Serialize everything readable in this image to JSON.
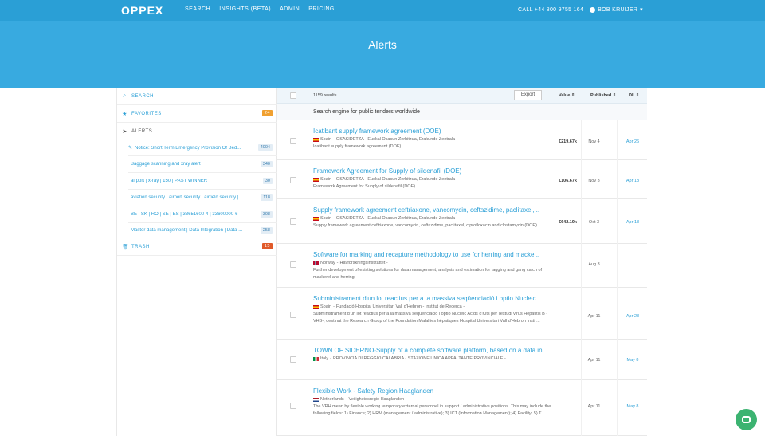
{
  "nav": {
    "logo": "OPPEX",
    "links": [
      "SEARCH",
      "INSIGHTS (BETA)",
      "ADMIN",
      "PRICING"
    ],
    "phone": "CALL +44 800 9755 164",
    "user": "BOB KRUIJER"
  },
  "page": {
    "title": "Alerts"
  },
  "sidebar": {
    "search": "SEARCH",
    "favorites": {
      "label": "FAVORITES",
      "count": "24"
    },
    "alerts": "ALERTS",
    "alert_items": [
      {
        "label": "Notice: Short Term Emergency Provision Of Bed...",
        "count": "4004"
      },
      {
        "label": "Baggage scanning and xray alert",
        "count": "340"
      },
      {
        "label": "airport | x-ray | 150 | PAST WINNER",
        "count": "30"
      },
      {
        "label": "aviation security | airport security | airfield security |...",
        "count": "118"
      },
      {
        "label": "BE | SK | RO | SE | ES | 33651600-4 | 33600000-6",
        "count": "308"
      },
      {
        "label": "Master data management | Data Integration | Data ...",
        "count": "258"
      }
    ],
    "trash": {
      "label": "TRASH",
      "count": "15"
    }
  },
  "table": {
    "results": "1159 results",
    "export": "Export",
    "col_value": "Value ⇕",
    "col_published": "Published ⇕",
    "col_dl": "DL ⇕",
    "subheading": "Search engine for public tenders worldwide"
  },
  "rows": [
    {
      "title": "Icatibant supply framework agreement (DOE)",
      "country": "Spain",
      "meta": "OSAKIDETZA - Euskal Osasun Zerbitzua, Erakunde Zentrala -",
      "desc": "Icatibant supply framework agreement (DOE)",
      "value": "€219.67k",
      "published": "Nov 4",
      "dl": "Apr 26",
      "flag": "es"
    },
    {
      "title": "Framework Agreement for Supply of sildenafil (DOE)",
      "country": "Spain",
      "meta": "OSAKIDETZA - Euskal Osasun Zerbitzua, Erakunde Zentrala -",
      "desc": "Framework Agreement for Supply of sildenafil (DOE)",
      "value": "€106.67k",
      "published": "Nov 3",
      "dl": "Apr 18",
      "flag": "es"
    },
    {
      "title": "Supply framework agreement ceftriaxone, vancomycin, ceftazidime, paclitaxel,...",
      "country": "Spain",
      "meta": "OSAKIDETZA - Euskal Osasun Zerbitzua, Erakunde Zentrala -",
      "desc": "Supply framework agreement ceftriaxone, vancomycin, ceftazidime, paclitaxel, ciprofloxacin and clostamycin (DOE)",
      "value": "€642.19k",
      "published": "Oct 3",
      "dl": "Apr 18",
      "flag": "es"
    },
    {
      "title": "Software for marking and recapture methodology to use for herring and macke...",
      "country": "Norway",
      "meta": "Havforskningsinstituttet -",
      "desc": "Further development of existing solutions for data management, analysis and estimation for tagging and gang catch of mackerel and herring",
      "value": "",
      "published": "Aug 3",
      "dl": "",
      "flag": "no"
    },
    {
      "title": "Subministrament d'un lot reactius per a la massiva seqüenciació i optio Nucleic...",
      "country": "Spain",
      "meta": "Fundació Hospital Universitari Vall d'Hebron - Institut de Recerca -",
      "desc": "Subministrament d'un lot reactius per a la massiva seqüenciació i optio Nucleic Acids d'Kits per l'estudi virus Hepatitis B -VHB-, destinat the Research Group of the Foundation Malalties hèpatiques Hospital Universitari Vall d'Hebron Insti ...",
      "value": "",
      "published": "Apr 11",
      "dl": "Apr 28",
      "flag": "es"
    },
    {
      "title": "TOWN OF SIDERNO-Supply of a complete software platform, based on a data in...",
      "country": "Italy",
      "meta": "PROVINCIA DI REGGIO CALABRIA - STAZIONE UNICA APPALTANTE PROVINCIALE -",
      "desc": "",
      "value": "",
      "published": "Apr 11",
      "dl": "May 8",
      "flag": "it"
    },
    {
      "title": "Flexible Work - Safety Region Haaglanden",
      "country": "Netherlands",
      "meta": "Veiligheidsregio Haaglanden -",
      "desc": "The VRH mean by flexible working temporary external personnel in support / administrative positions. This may include the following fields: 1) Finance; 2) HRM (management / administrative); 3) ICT (Information Management); 4) Facility; 5) T ...",
      "value": "",
      "published": "Apr 11",
      "dl": "May 8",
      "flag": "nl"
    }
  ],
  "colors": {
    "primary": "#2a9fd6",
    "hero": "#38aae0",
    "chat": "#3cb371"
  }
}
